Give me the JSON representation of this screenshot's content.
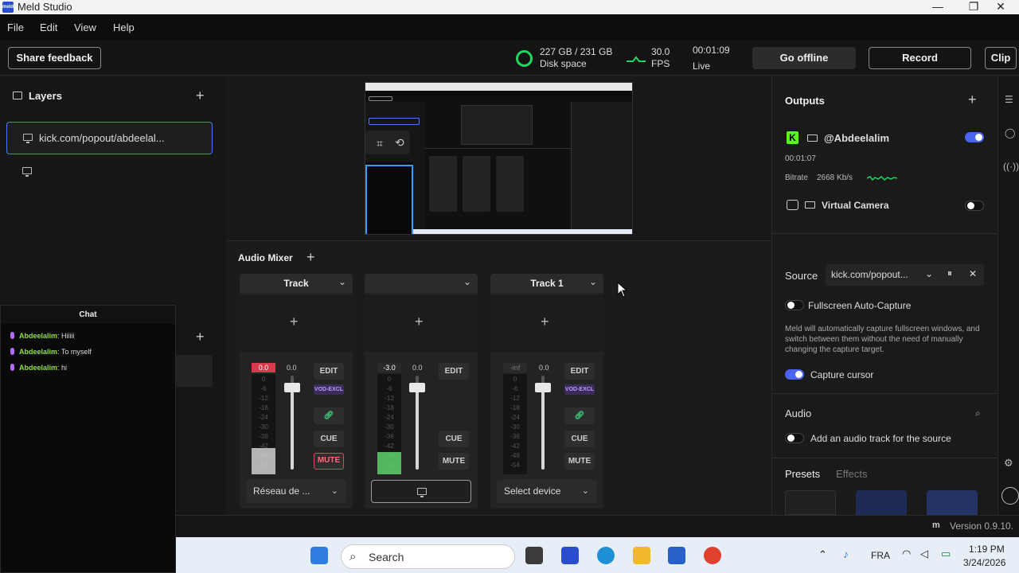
{
  "window": {
    "title": "Meld Studio",
    "logo_text": "meld",
    "minimize": "—",
    "maximize": "❐",
    "close": "✕"
  },
  "menu": {
    "file": "File",
    "edit": "Edit",
    "view": "View",
    "help": "Help"
  },
  "toolbar": {
    "share_feedback": "Share feedback",
    "disk_value": "227 GB / 231 GB",
    "disk_label": "Disk space",
    "fps_value": "30.0",
    "fps_label": "FPS",
    "live_time": "00:01:09",
    "live_label": "Live",
    "go_offline": "Go offline",
    "record": "Record",
    "clip": "Clip",
    "accent_green": "#1ed760"
  },
  "layers": {
    "title": "Layers",
    "add": "+",
    "items": [
      {
        "label": "kick.com/popout/abdeelal..."
      },
      {
        "label": ""
      }
    ],
    "second_add": "+"
  },
  "chat": {
    "title": "Chat",
    "messages": [
      {
        "user": "Abdeelalim",
        "text": ": Hiiiii"
      },
      {
        "user": "Abdeelalim",
        "text": ": To myself"
      },
      {
        "user": "Abdeelalim",
        "text": ": hi"
      }
    ]
  },
  "mixer": {
    "title": "Audio Mixer",
    "add": "+",
    "tracks": [
      {
        "name": "Track",
        "peak": "0.0",
        "peak_color": "#d93a4b",
        "fader_value": "0.0",
        "fader_level": 0.87,
        "meter_fill": 0.26,
        "meter_color": "#d0d0d0",
        "device": "Réseau de ...",
        "has_vod": true,
        "has_link": true,
        "mute_active": true
      },
      {
        "name": "",
        "peak": "-3.0",
        "peak_color": "#2a2a2a",
        "fader_value": "0.0",
        "fader_level": 0.87,
        "meter_fill": 0.22,
        "meter_color": "#5fd36a",
        "device": "",
        "has_vod": false,
        "has_link": false,
        "mute_active": false
      },
      {
        "name": "Track 1",
        "peak": "-inf",
        "peak_color": "#2a2a2a",
        "fader_value": "0.0",
        "fader_level": 0.87,
        "meter_fill": 0.0,
        "meter_color": "#5fd36a",
        "device": "Select device",
        "has_vod": true,
        "has_link": true,
        "mute_active": false
      }
    ],
    "scale": [
      "0",
      "-6",
      "-12",
      "-18",
      "-24",
      "-30",
      "-36",
      "-42",
      "-48",
      "-54"
    ],
    "edit": "EDIT",
    "vod": "VOD-EXCL",
    "cue": "CUE",
    "mute": "MUTE",
    "plus": "+"
  },
  "outputs": {
    "title": "Outputs",
    "add": "+",
    "account": "@Abdeelalim",
    "account_enabled": true,
    "elapsed": "00:01:07",
    "bitrate_label": "Bitrate",
    "bitrate_value": "2668 Kb/s",
    "virtual_camera": "Virtual Camera",
    "virtual_camera_enabled": false,
    "kick_color": "#53fc18"
  },
  "source": {
    "label": "Source",
    "value": "kick.com/popout...",
    "fullscreen_auto": "Fullscreen Auto-Capture",
    "description": "Meld will automatically capture fullscreen windows, and switch between them without the need of manually changing the capture target.",
    "capture_cursor": "Capture cursor",
    "capture_cursor_enabled": true,
    "audio_title": "Audio",
    "audio_track": "Add an audio track for the source",
    "presets": "Presets",
    "effects": "Effects"
  },
  "status": {
    "version": "Version 0.9.10."
  },
  "taskbar": {
    "search": "Search",
    "lang": "FRA",
    "time": "1:19 PM",
    "date": "3/24/2026"
  }
}
